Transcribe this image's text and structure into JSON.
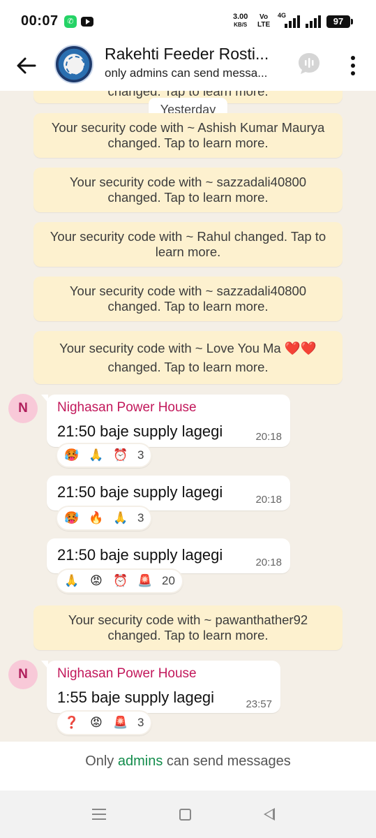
{
  "status_bar": {
    "time": "00:07",
    "speed_value": "3.00",
    "speed_unit": "KB/S",
    "volte_top": "Vo",
    "volte_bottom": "LTE",
    "network_type": "4G",
    "battery": "97"
  },
  "header": {
    "group_name": "Rakehti Feeder Rosti...",
    "subtitle": "only admins can send messa..."
  },
  "chat": {
    "partial_top_message": "changed. Tap to learn more.",
    "date_label": "Yesterday",
    "system_messages": [
      "Your security code with ~ Ashish Kumar Maurya changed. Tap to learn more.",
      "Your security code with ~ sazzadali40800 changed. Tap to learn more.",
      "Your security code with ~ Rahul changed. Tap to learn more.",
      "Your security code with ~ sazzadali40800 changed. Tap to learn more.",
      "Your security code with ~ Love You Ma ❤️❤️ changed. Tap to learn more.",
      "Your security code with ~ pawanthather92 changed. Tap to learn more."
    ],
    "messages": [
      {
        "avatar_letter": "N",
        "sender": "Nighasan Power House",
        "text": "21:50 baje supply lagegi",
        "time": "20:18",
        "reactions": [
          "🥵",
          "🙏",
          "⏰"
        ],
        "reaction_count": "3"
      },
      {
        "text": "21:50 baje supply lagegi",
        "time": "20:18",
        "reactions": [
          "🥵",
          "🔥",
          "🙏"
        ],
        "reaction_count": "3"
      },
      {
        "text": "21:50 baje supply lagegi",
        "time": "20:18",
        "reactions": [
          "🙏",
          "😡",
          "⏰",
          "🚨"
        ],
        "reaction_count": "20"
      },
      {
        "avatar_letter": "N",
        "sender": "Nighasan Power House",
        "text": "1:55 baje supply lagegi",
        "time": "23:57",
        "reactions": [
          "❓",
          "😡",
          "🚨"
        ],
        "reaction_count": "3"
      }
    ]
  },
  "footer": {
    "prefix": "Only ",
    "link": "admins",
    "suffix": " can send messages"
  },
  "icons": {
    "back": "arrow-left-icon",
    "call": "voice-chat-icon",
    "menu": "more-vertical-icon"
  },
  "colors": {
    "chat_background": "#f4efe7",
    "system_bubble": "#fdf1cf",
    "sender_name": "#c2185b",
    "admin_link": "#128c4b"
  }
}
